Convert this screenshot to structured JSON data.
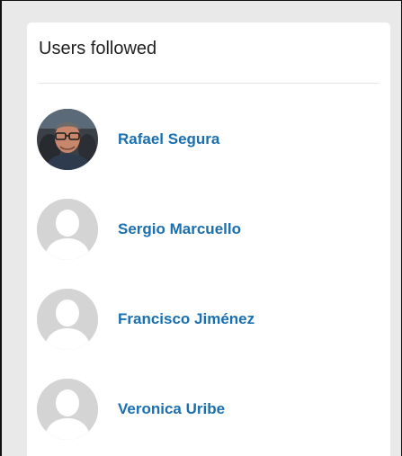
{
  "widget": {
    "title": "Users followed"
  },
  "users": [
    {
      "name": "Rafael Segura",
      "avatar": "user-photo"
    },
    {
      "name": "Sergio Marcuello",
      "avatar": "default-avatar-icon"
    },
    {
      "name": "Francisco Jiménez",
      "avatar": "default-avatar-icon"
    },
    {
      "name": "Veronica Uribe",
      "avatar": "default-avatar-icon"
    }
  ],
  "colors": {
    "link": "#1a6fb0",
    "avatar_placeholder_bg": "#d4d4d4",
    "avatar_placeholder_fg": "#ffffff"
  }
}
